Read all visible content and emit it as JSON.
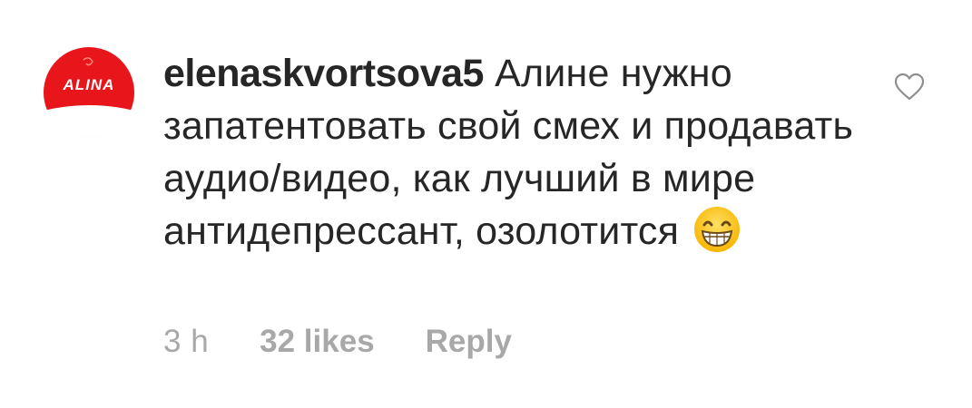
{
  "comment": {
    "avatar": {
      "logo_text": "ALINA",
      "colors": {
        "red": "#e8151b",
        "white": "#ffffff",
        "text": "#ffffff"
      }
    },
    "username": "elenaskvortsova5",
    "text": "Алине нужно запатентовать свой смех и продавать аудио/видео, как лучший в мире антидепрессант, озолотится",
    "emoji": "grinning-face-with-smiling-eyes",
    "meta": {
      "time": "3 h",
      "likes": "32 likes",
      "reply": "Reply"
    },
    "like_icon": "heart-outline-icon"
  },
  "colors": {
    "primary_text": "#262626",
    "secondary_text": "#a8a8a8",
    "heart_stroke": "#8e8e8e"
  }
}
